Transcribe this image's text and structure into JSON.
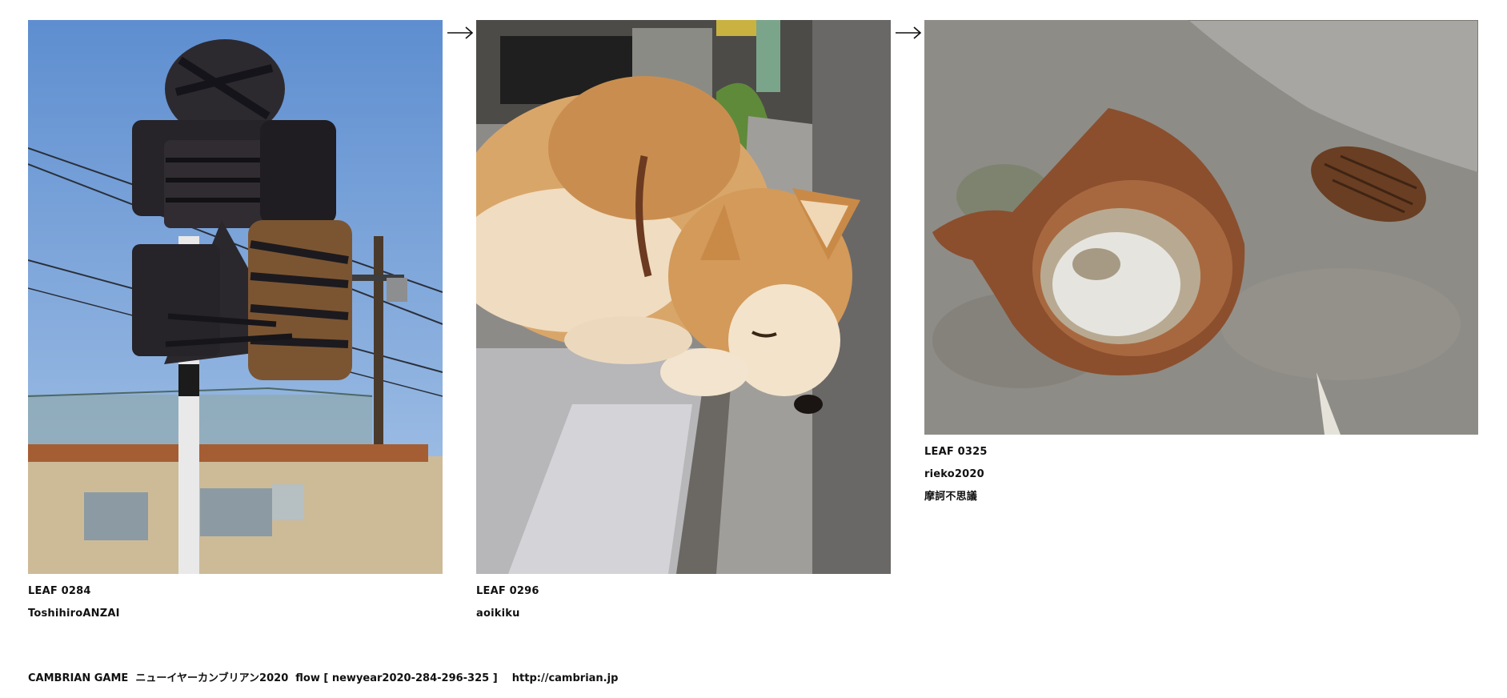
{
  "leaves": [
    {
      "title": "LEAF 0284",
      "author": "ToshihiroANZAI",
      "note": "",
      "image": "photo of street signs wrapped in black cloth and tape against blue sky, utility pole and school building"
    },
    {
      "title": "LEAF 0296",
      "author": "aoikiku",
      "note": "",
      "image": "photo of a sleeping shiba inu dog resting head on stone curb"
    },
    {
      "title": "LEAF 0325",
      "author": "rieko2020",
      "note": "摩訶不思議",
      "image": "photo of a rusty broken can holding rainwater next to a pine cone on pavement"
    }
  ],
  "arrows": [
    "arrow-right-icon",
    "arrow-right-icon"
  ],
  "footer": {
    "text": "CAMBRIAN GAME  ニューイヤーカンブリアン2020  flow [ newyear2020-284-296-325 ]    http://cambrian.jp"
  },
  "colors": {
    "background": "#ffffff",
    "text": "#111111"
  }
}
